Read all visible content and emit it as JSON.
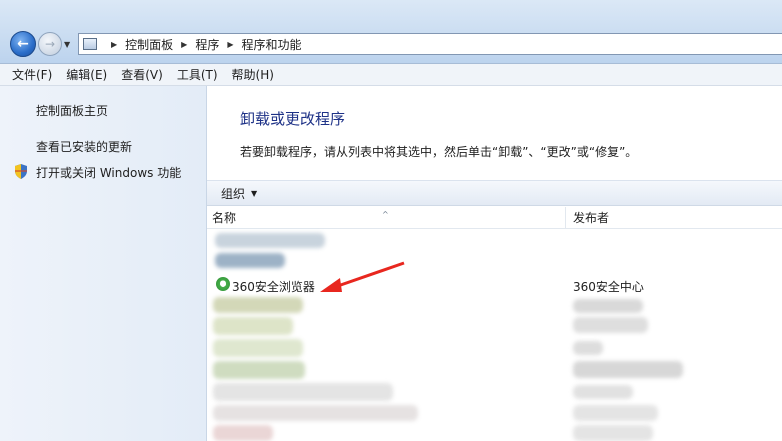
{
  "breadcrumb": [
    "控制面板",
    "程序",
    "程序和功能"
  ],
  "menu": [
    "文件(F)",
    "编辑(E)",
    "查看(V)",
    "工具(T)",
    "帮助(H)"
  ],
  "sidebar": {
    "home": "控制面板主页",
    "updates": "查看已安装的更新",
    "features": "打开或关闭 Windows 功能"
  },
  "main": {
    "title": "卸载或更改程序",
    "description": "若要卸载程序，请从列表中将其选中，然后单击“卸载”、“更改”或“修复”。"
  },
  "toolbar": {
    "organize": "组织"
  },
  "columns": {
    "name": "名称",
    "publisher": "发布者"
  },
  "programs": [
    {
      "name": "360安全浏览器",
      "publisher": "360安全中心"
    }
  ],
  "icons": {
    "back": "back-arrow-icon",
    "forward": "forward-arrow-icon",
    "shield": "shield-icon",
    "program": "browser-e-icon"
  },
  "colors": {
    "title_blue": "#1e3287",
    "arrow_red": "#e8271f"
  }
}
